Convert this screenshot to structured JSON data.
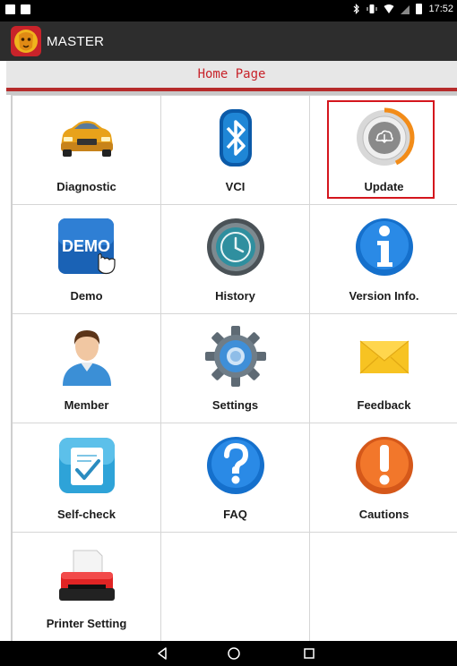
{
  "status_bar": {
    "time": "17:52"
  },
  "app": {
    "title": "MASTER",
    "logo": "lion-logo-icon"
  },
  "page_header": {
    "title": "Home Page"
  },
  "grid": [
    {
      "label": "Diagnostic",
      "icon": "car-icon"
    },
    {
      "label": "VCI",
      "icon": "bluetooth-icon"
    },
    {
      "label": "Update",
      "icon": "cloud-download-icon"
    },
    {
      "label": "Demo",
      "icon": "demo-icon"
    },
    {
      "label": "History",
      "icon": "clock-icon"
    },
    {
      "label": "Version Info.",
      "icon": "info-icon"
    },
    {
      "label": "Member",
      "icon": "person-icon"
    },
    {
      "label": "Settings",
      "icon": "gear-icon"
    },
    {
      "label": "Feedback",
      "icon": "envelope-icon"
    },
    {
      "label": "Self-check",
      "icon": "clipboard-check-icon"
    },
    {
      "label": "FAQ",
      "icon": "question-icon"
    },
    {
      "label": "Cautions",
      "icon": "exclamation-icon"
    },
    {
      "label": "Printer Setting",
      "icon": "printer-icon"
    }
  ],
  "highlighted_item": "Update",
  "colors": {
    "accent_red": "#c8232a",
    "divider_red": "#b62b2b",
    "app_bar": "#2d2d2d"
  },
  "nav_bar": {
    "items": [
      "back-icon",
      "home-icon",
      "recents-icon"
    ]
  }
}
